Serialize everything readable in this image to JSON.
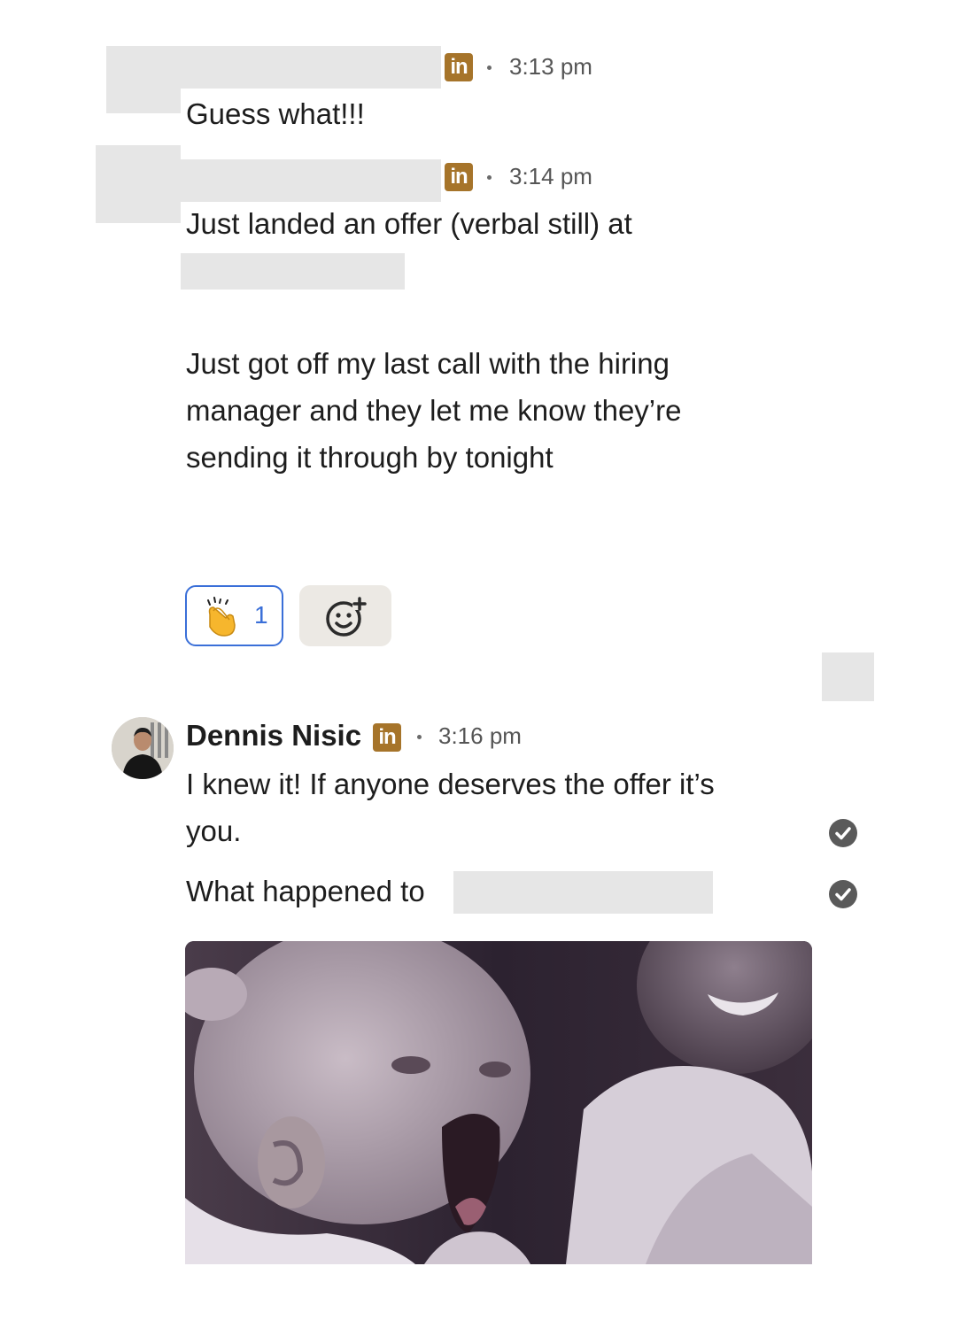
{
  "messages": [
    {
      "time": "3:13 pm",
      "text": "Guess what!!!"
    },
    {
      "time": "3:14 pm",
      "line1": "Just landed an offer (verbal still) at",
      "para2": [
        "Just got off my last call with the hiring",
        "manager and they let me know they’re",
        "sending it through by tonight"
      ]
    }
  ],
  "reactions": {
    "clap_count": "1"
  },
  "reply": {
    "sender": "Dennis Nisic",
    "time": "3:16 pm",
    "lines": [
      "I knew it! If anyone deserves the offer it’s",
      "you."
    ],
    "second": "What happened to"
  },
  "badge_text": "in",
  "icons": [
    "linkedin-icon",
    "clap-emoji-icon",
    "add-reaction-icon",
    "read-check-icon",
    "avatar"
  ],
  "colors": {
    "linkedin_badge": "#a6742a",
    "reaction_border": "#3a6fd8",
    "redaction": "#e6e6e6"
  }
}
